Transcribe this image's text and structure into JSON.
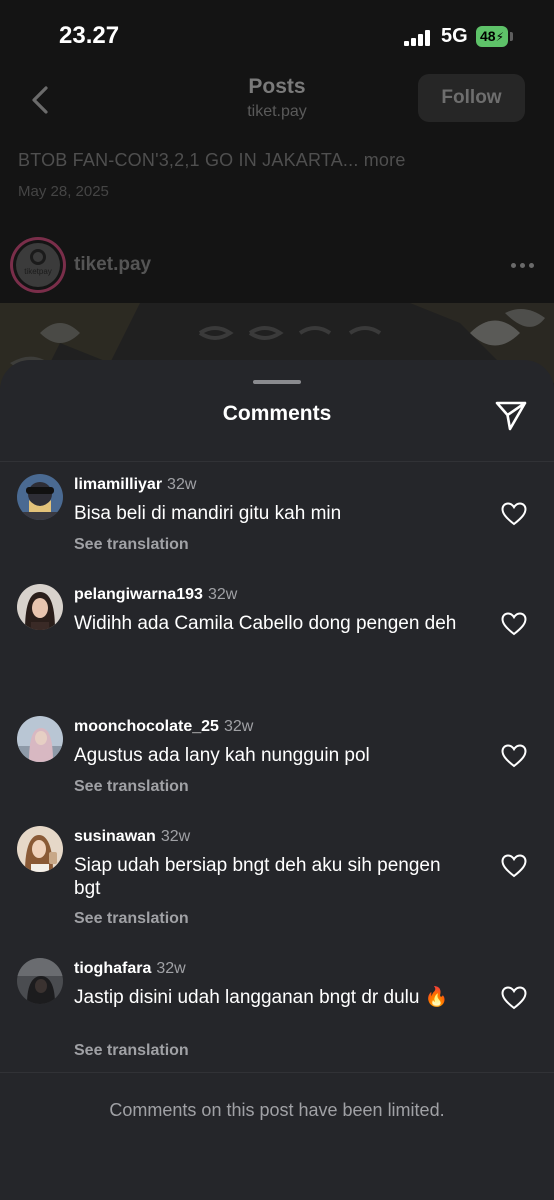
{
  "status_bar": {
    "time": "23.27",
    "network": "5G",
    "battery": "48"
  },
  "header": {
    "title": "Posts",
    "subtitle": "tiket.pay",
    "follow_label": "Follow"
  },
  "post": {
    "caption": "BTOB FAN-CON'3,2,1 GO IN JAKARTA...",
    "more_label": "more",
    "date": "May 28, 2025",
    "author": "tiket.pay",
    "author_logo_text": "tiketpay"
  },
  "sheet": {
    "title": "Comments",
    "comments": [
      {
        "user": "limamilliyar",
        "time": "32w",
        "text": "Bisa beli di mandiri gitu kah min",
        "translation": "See translation"
      },
      {
        "user": "pelangiwarna193",
        "time": "32w",
        "text": "Widihh ada Camila Cabello dong pengen deh",
        "translation": ""
      },
      {
        "user": "moonchocolate_25",
        "time": "32w",
        "text": "Agustus ada lany kah nungguin pol",
        "translation": "See translation"
      },
      {
        "user": "susinawan",
        "time": "32w",
        "text": "Siap udah bersiap bngt deh aku sih pengen bgt",
        "translation": "See translation"
      },
      {
        "user": "tioghafara",
        "time": "32w",
        "text": "Jastip disini udah langganan bngt dr dulu 🔥",
        "translation": "See translation"
      }
    ],
    "limited_notice": "Comments on this post have been limited."
  },
  "colors": {
    "sheet_bg": "#25262a",
    "muted_text": "#a0a1a5",
    "battery_green": "#5ec269"
  },
  "icons": [
    "back-chevron-icon",
    "more-dots-icon",
    "share-send-icon",
    "heart-icon"
  ]
}
